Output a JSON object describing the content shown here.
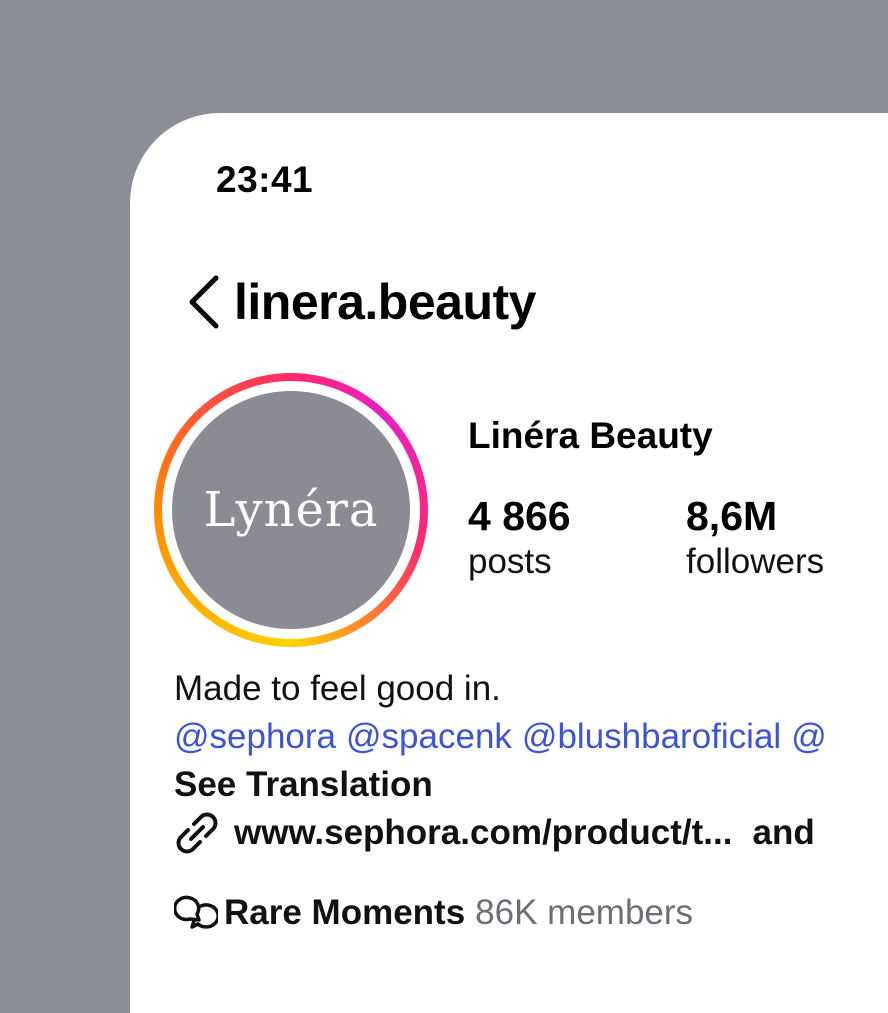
{
  "status_bar": {
    "time": "23:41"
  },
  "header": {
    "username": "linera.beauty",
    "back_icon": "chevron-left-icon"
  },
  "profile": {
    "avatar_text": "Lynéra",
    "display_name": "Linéra Beauty",
    "stats": [
      {
        "value": "4 866",
        "label": "posts"
      },
      {
        "value": "8,6M",
        "label": "followers"
      }
    ]
  },
  "bio": {
    "line1": "Made to feel good in.",
    "mentions": [
      "@sephora",
      "@spacenk",
      "@blushbaroficial",
      "@"
    ],
    "see_translation": "See Translation",
    "link_text": "www.sephora.com/product/t...",
    "link_more": "and",
    "link_icon": "link-icon"
  },
  "channel": {
    "icon": "chat-bubbles-icon",
    "name": "Rare Moments",
    "members": "86K members"
  },
  "colors": {
    "mention": "#3b55d6",
    "ring_start": "#ffd400",
    "ring_end": "#e81ec8",
    "avatar_bg": "#8b8c93"
  }
}
